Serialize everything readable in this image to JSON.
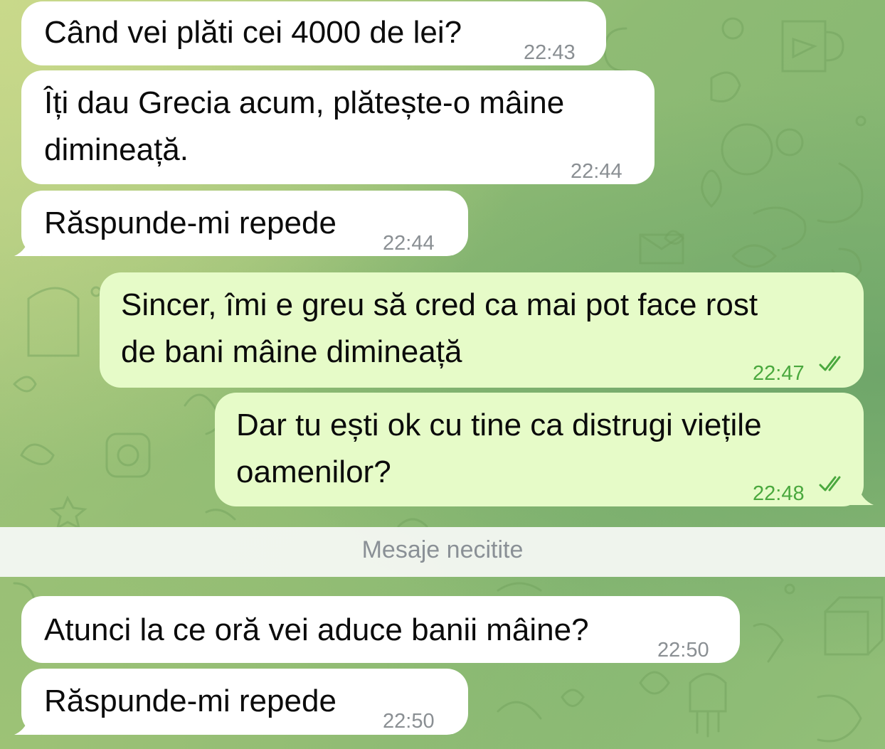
{
  "chat": {
    "messages": [
      {
        "id": "m1",
        "direction": "incoming",
        "lines": [
          "Când vei plăti cei 4000 de lei?"
        ],
        "time": "22:43"
      },
      {
        "id": "m2",
        "direction": "incoming",
        "lines": [
          "Îți dau Grecia acum, plătește-o mâine",
          "dimineață."
        ],
        "time": "22:44"
      },
      {
        "id": "m3",
        "direction": "incoming",
        "lines": [
          "Răspunde-mi repede"
        ],
        "time": "22:44"
      },
      {
        "id": "m4",
        "direction": "outgoing",
        "lines": [
          "Sincer, îmi e greu să cred ca mai pot face rost",
          "de bani mâine dimineață"
        ],
        "time": "22:47",
        "status": "read"
      },
      {
        "id": "m5",
        "direction": "outgoing",
        "lines": [
          "Dar tu ești ok cu tine ca distrugi viețile",
          "oamenilor?"
        ],
        "time": "22:48",
        "status": "read"
      },
      {
        "id": "m6",
        "direction": "incoming",
        "lines": [
          "Atunci la ce oră vei aduce banii mâine?"
        ],
        "time": "22:50"
      },
      {
        "id": "m7",
        "direction": "incoming",
        "lines": [
          "Răspunde-mi repede"
        ],
        "time": "22:50"
      }
    ],
    "unread_divider": "Mesaje necitite"
  },
  "colors": {
    "incoming_bubble": "#ffffff",
    "outgoing_bubble": "#e6fbc8",
    "outgoing_time": "#4aa83e",
    "incoming_time": "#8a8f93",
    "read_check": "#4aa83e"
  },
  "icons": {
    "read_receipt": "double-check-icon"
  }
}
